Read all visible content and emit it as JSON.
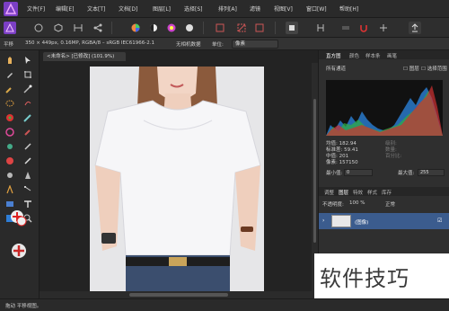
{
  "menu": {
    "items": [
      "文件[F]",
      "编辑[E]",
      "文本[T]",
      "文档[D]",
      "图层[L]",
      "选择[S]",
      "排列[A]",
      "滤镜",
      "视图[V]",
      "窗口[W]",
      "帮助[H]"
    ]
  },
  "context": {
    "mode_label": "平移",
    "info": "350 × 449px, 0.16MP, RGBA/8 – sRGB IEC61966-2.1",
    "profile": "无相机数据",
    "unit_label": "单位:",
    "unit_value": "像素"
  },
  "document": {
    "tab_title": "<未命名> [已修改] (101.9%)"
  },
  "histogram_panel": {
    "tabs": [
      "直方图",
      "颜色",
      "样本条",
      "画笔"
    ],
    "channel_select": "所有通道",
    "checkbox_layer": "图层",
    "checkbox_selection": "选择范围",
    "stats": {
      "mean": "均值: 182.94",
      "std_dev": "标准差: 59.41",
      "median": "中值: 201",
      "pixels": "像素: 157150",
      "min_label": "最小值:",
      "min_value": "0",
      "max_label": "最大值:",
      "max_value": "255"
    },
    "right_labels": [
      "级别:",
      "数量:",
      "百分比:"
    ]
  },
  "layers_panel": {
    "tabs": [
      "调整",
      "图层",
      "特效",
      "样式",
      "库存"
    ],
    "opacity_label": "不透明度:",
    "opacity_value": "100 %",
    "blend_mode": "正常",
    "layer_name": "(图像)"
  },
  "status": {
    "text": "拖动 平移视图。"
  },
  "watermark": {
    "text": "软件技巧"
  },
  "colors": {
    "accent": "#3b5c8e",
    "app_logo": "#7b3fc4",
    "image_bg": "#e6e6e8"
  }
}
